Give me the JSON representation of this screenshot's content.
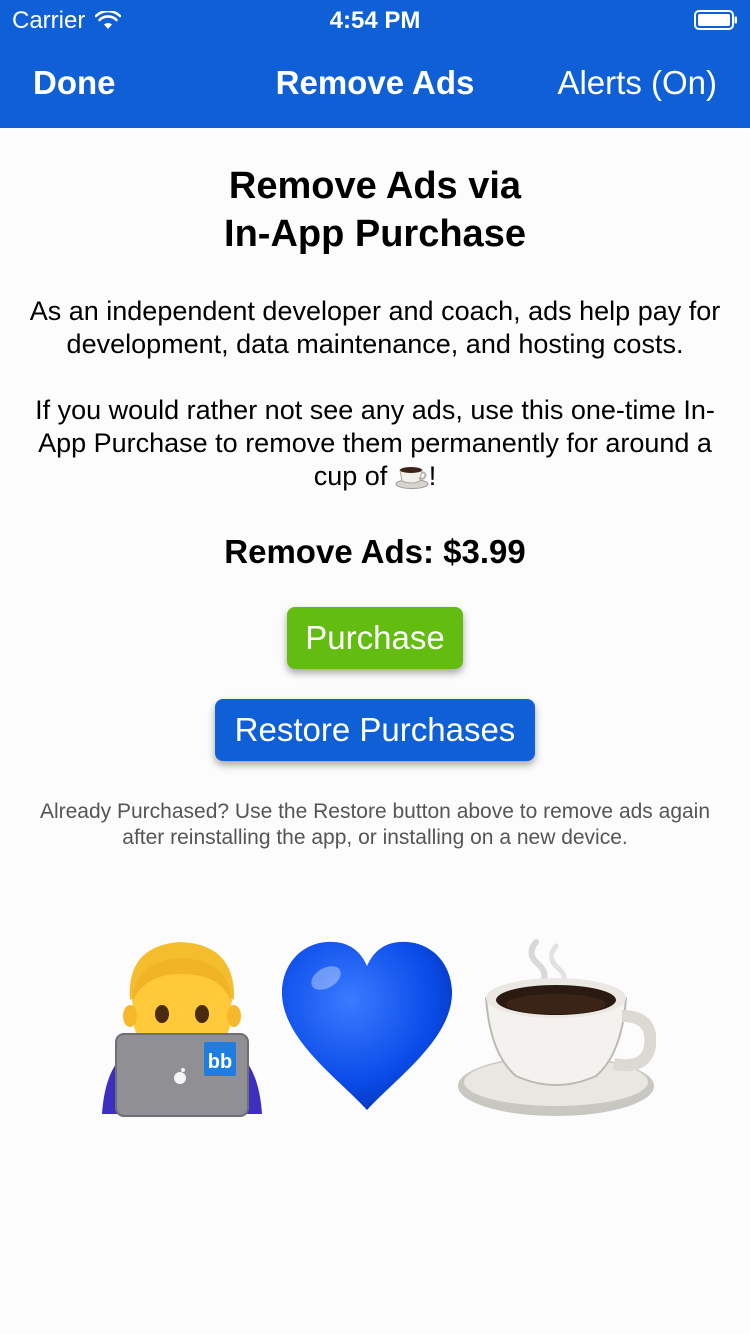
{
  "status_bar": {
    "carrier": "Carrier",
    "time": "4:54 PM",
    "wifi_icon": "wifi-icon",
    "battery_icon": "battery-icon"
  },
  "nav": {
    "done_label": "Done",
    "title": "Remove Ads",
    "alerts_label": "Alerts (On)"
  },
  "content": {
    "heading_line1": "Remove Ads via",
    "heading_line2": "In-App Purchase",
    "paragraph1": "As an independent developer and coach, ads help pay for development, data maintenance, and hosting costs.",
    "paragraph2_text": "If you would rather not see any ads, use this one-time In-App Purchase to remove them permanently for around a cup of",
    "paragraph2_end": "!",
    "price_text": "Remove Ads: $3.99",
    "purchase_label": "Purchase",
    "restore_label": "Restore Purchases",
    "note": "Already Purchased? Use the Restore button above to remove ads again after reinstalling the app, or installing on a new device."
  },
  "icons": {
    "inline_coffee": "coffee-cup-icon",
    "developer": "man-technologist-icon",
    "heart": "blue-heart-icon",
    "coffee": "coffee-cup-icon"
  },
  "colors": {
    "brand_blue": "#0f5fd6",
    "purchase_green": "#62bd10",
    "note_gray": "#555555",
    "heart_blue": "#0a4be8"
  }
}
